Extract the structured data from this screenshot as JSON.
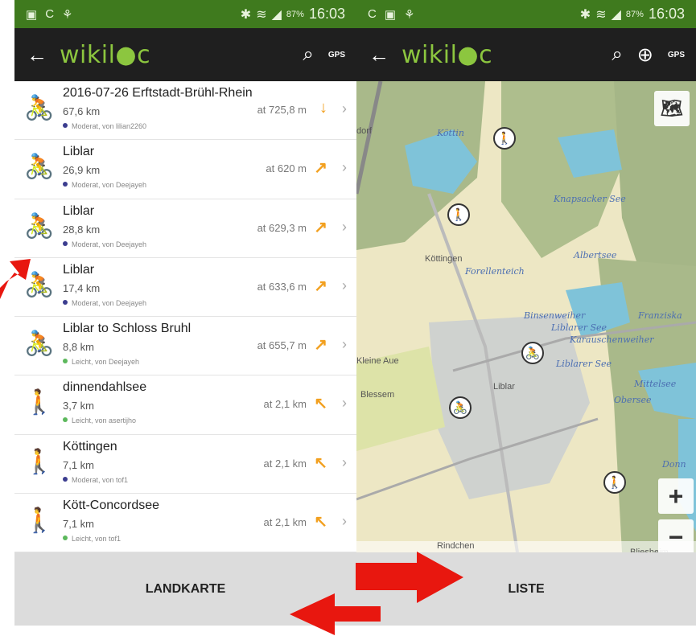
{
  "status": {
    "left_icons": [
      "▣",
      "C",
      "⚘"
    ],
    "right_icons": [
      "✱",
      "≋",
      "◢"
    ],
    "battery": "87%",
    "time": "16:03"
  },
  "appbar": {
    "back_icon": "←",
    "logo_prefix": "wikil",
    "logo_suffix": "c",
    "search_icon": "⌕",
    "zoom_icon": "⊕",
    "gps_label": "GPS"
  },
  "colors": {
    "statusbar": "#3f7a1e",
    "appbar": "#1f1f1f",
    "logo": "#8cc63f",
    "trend": "#f2a01f",
    "arrow": "#e8170f"
  },
  "list": [
    {
      "icon": "bike-icon",
      "title": "2016-07-26 Erftstadt-Brühl-Rhein",
      "distance": "67,6 km",
      "meta": "Moderat, von lilian2260",
      "dot": "#3b3d8f",
      "altitude": "at 725,8 m",
      "trend": "↓"
    },
    {
      "icon": "bike-icon",
      "title": "Liblar",
      "distance": "26,9 km",
      "meta": "Moderat, von Deejayeh",
      "dot": "#3b3d8f",
      "altitude": "at 620 m",
      "trend": "↗"
    },
    {
      "icon": "bike-icon",
      "title": "Liblar",
      "distance": "28,8 km",
      "meta": "Moderat, von Deejayeh",
      "dot": "#3b3d8f",
      "altitude": "at 629,3 m",
      "trend": "↗"
    },
    {
      "icon": "bike-icon",
      "title": "Liblar",
      "distance": "17,4 km",
      "meta": "Moderat, von Deejayeh",
      "dot": "#3b3d8f",
      "altitude": "at 633,6 m",
      "trend": "↗"
    },
    {
      "icon": "bike-icon",
      "title": "Liblar to Schloss Bruhl",
      "distance": "8,8 km",
      "meta": "Leicht, von Deejayeh",
      "dot": "#5cb85c",
      "altitude": "at 655,7 m",
      "trend": "↗"
    },
    {
      "icon": "hiker-icon",
      "title": "dinnendahlsee",
      "distance": "3,7 km",
      "meta": "Leicht, von asertijho",
      "dot": "#5cb85c",
      "altitude": "at 2,1 km",
      "trend": "↖"
    },
    {
      "icon": "hiker-icon",
      "title": "Köttingen",
      "distance": "7,1 km",
      "meta": "Moderat, von tof1",
      "dot": "#3b3d8f",
      "altitude": "at 2,1 km",
      "trend": "↖"
    },
    {
      "icon": "hiker-icon",
      "title": "Kött-Concordsee",
      "distance": "7,1 km",
      "meta": "Leicht, von tof1",
      "dot": "#5cb85c",
      "altitude": "at 2,1 km",
      "trend": "↖"
    }
  ],
  "icons": {
    "bike": "🚴",
    "hiker": "🚶",
    "chevron": "›",
    "plus": "+",
    "minus": "−",
    "layers": "🗺"
  },
  "left_bottom": {
    "label": "LANDKARTE"
  },
  "right_bottom": {
    "label": "LISTE"
  },
  "map": {
    "labels": [
      {
        "text": "dorf",
        "kind": "dark"
      },
      {
        "text": "Köttin",
        "kind": "lake"
      },
      {
        "text": "Knapsacker See",
        "kind": "lake"
      },
      {
        "text": "Köttingen",
        "kind": "dark"
      },
      {
        "text": "Forellenteich",
        "kind": "lake"
      },
      {
        "text": "Albertsee",
        "kind": "lake"
      },
      {
        "text": "Binsenweiher",
        "kind": "lake"
      },
      {
        "text": "Liblarer See",
        "kind": "lake"
      },
      {
        "text": "Karauschenweiher",
        "kind": "lake"
      },
      {
        "text": "Franziska",
        "kind": "lake"
      },
      {
        "text": "Liblarer See",
        "kind": "lake"
      },
      {
        "text": "Kleine Aue",
        "kind": "dark"
      },
      {
        "text": "Blessem",
        "kind": "dark"
      },
      {
        "text": "Liblar",
        "kind": "dark"
      },
      {
        "text": "Mittelsee",
        "kind": "lake"
      },
      {
        "text": "Obersee",
        "kind": "lake"
      },
      {
        "text": "Donn",
        "kind": "lake"
      },
      {
        "text": "Bliesheim",
        "kind": "dark"
      },
      {
        "text": "Rindchen",
        "kind": "dark"
      }
    ]
  }
}
